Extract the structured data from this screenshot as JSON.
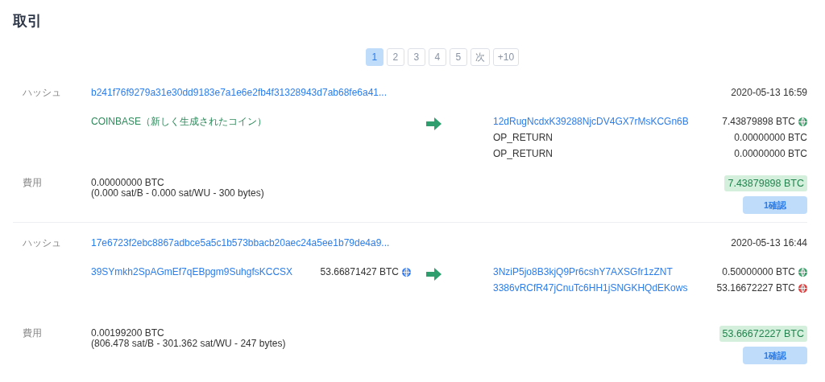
{
  "title": "取引",
  "pagination": [
    {
      "label": "1",
      "selected": true
    },
    {
      "label": "2",
      "selected": false
    },
    {
      "label": "3",
      "selected": false
    },
    {
      "label": "4",
      "selected": false
    },
    {
      "label": "5",
      "selected": false
    },
    {
      "label": "次",
      "selected": false
    },
    {
      "label": "+10",
      "selected": false
    }
  ],
  "transactions": [
    {
      "hash_label": "ハッシュ",
      "hash": "b241f76f9279a31e30dd9183e7a1e6e2fb4f31328943d7ab68fe6a41...",
      "time": "2020-05-13 16:59",
      "inputs": [
        {
          "kind": "coinbase",
          "text": "COINBASE（新しく生成されたコイン）"
        }
      ],
      "outputs": [
        {
          "kind": "address",
          "address": "12dRugNcdxK39288NjcDV4GX7rMsKCGn6B",
          "amount": "7.43879898 BTC",
          "color": "#38a169"
        },
        {
          "kind": "op_return",
          "address": "OP_RETURN",
          "amount": "0.00000000 BTC"
        },
        {
          "kind": "op_return",
          "address": "OP_RETURN",
          "amount": "0.00000000 BTC"
        }
      ],
      "fee_label": "費用",
      "fee": "0.00000000 BTC",
      "fee_detail": "(0.000 sat/B - 0.000 sat/WU - 300 bytes)",
      "total": "7.43879898 BTC",
      "confirmations": "1確認"
    },
    {
      "hash_label": "ハッシュ",
      "hash": "17e6723f2ebc8867adbce5a5c1b573bbacb20aec24a5ee1b79de4a9...",
      "time": "2020-05-13 16:44",
      "inputs": [
        {
          "kind": "address",
          "text": "39SYmkh2SpAGmEf7qEBpgm9SuhgfsKCCSX",
          "amount": "53.66871427 BTC",
          "color": "#3b82f6"
        }
      ],
      "outputs": [
        {
          "kind": "address",
          "address": "3NziP5jo8B3kjQ9Pr6cshY7AXSGfr1zZNT",
          "amount": "0.50000000 BTC",
          "color": "#38a169"
        },
        {
          "kind": "address",
          "address": "3386vRCfR47jCnuTc6HH1jSNGKHQdEKows",
          "amount": "53.16672227 BTC",
          "color": "#e53e3e"
        }
      ],
      "fee_label": "費用",
      "fee": "0.00199200 BTC",
      "fee_detail": "(806.478 sat/B - 301.362 sat/WU - 247 bytes)",
      "total": "53.66672227 BTC",
      "confirmations": "1確認"
    }
  ]
}
